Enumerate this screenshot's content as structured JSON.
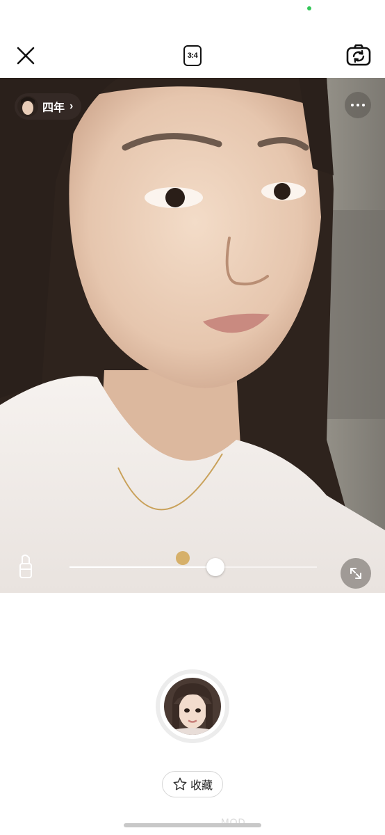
{
  "status_bar": {
    "indicator_color": "#34c759"
  },
  "top_bar": {
    "close_icon": "close-icon",
    "aspect_ratio": "3:4",
    "switch_camera_icon": "camera-switch-icon"
  },
  "preview": {
    "filter": {
      "name": "四年",
      "thumbnail_icon": "filter-thumbnail",
      "chevron": "›"
    },
    "more_icon": "more-dots-icon",
    "makeup_icon": "lipstick-icon",
    "intensity": 0.59,
    "expand_icon": "expand-icon"
  },
  "shutter": {
    "style_thumbnail": "face-style-thumbnail"
  },
  "favorite": {
    "label": "收藏",
    "icon": "star-icon"
  },
  "watermark": "MOD"
}
